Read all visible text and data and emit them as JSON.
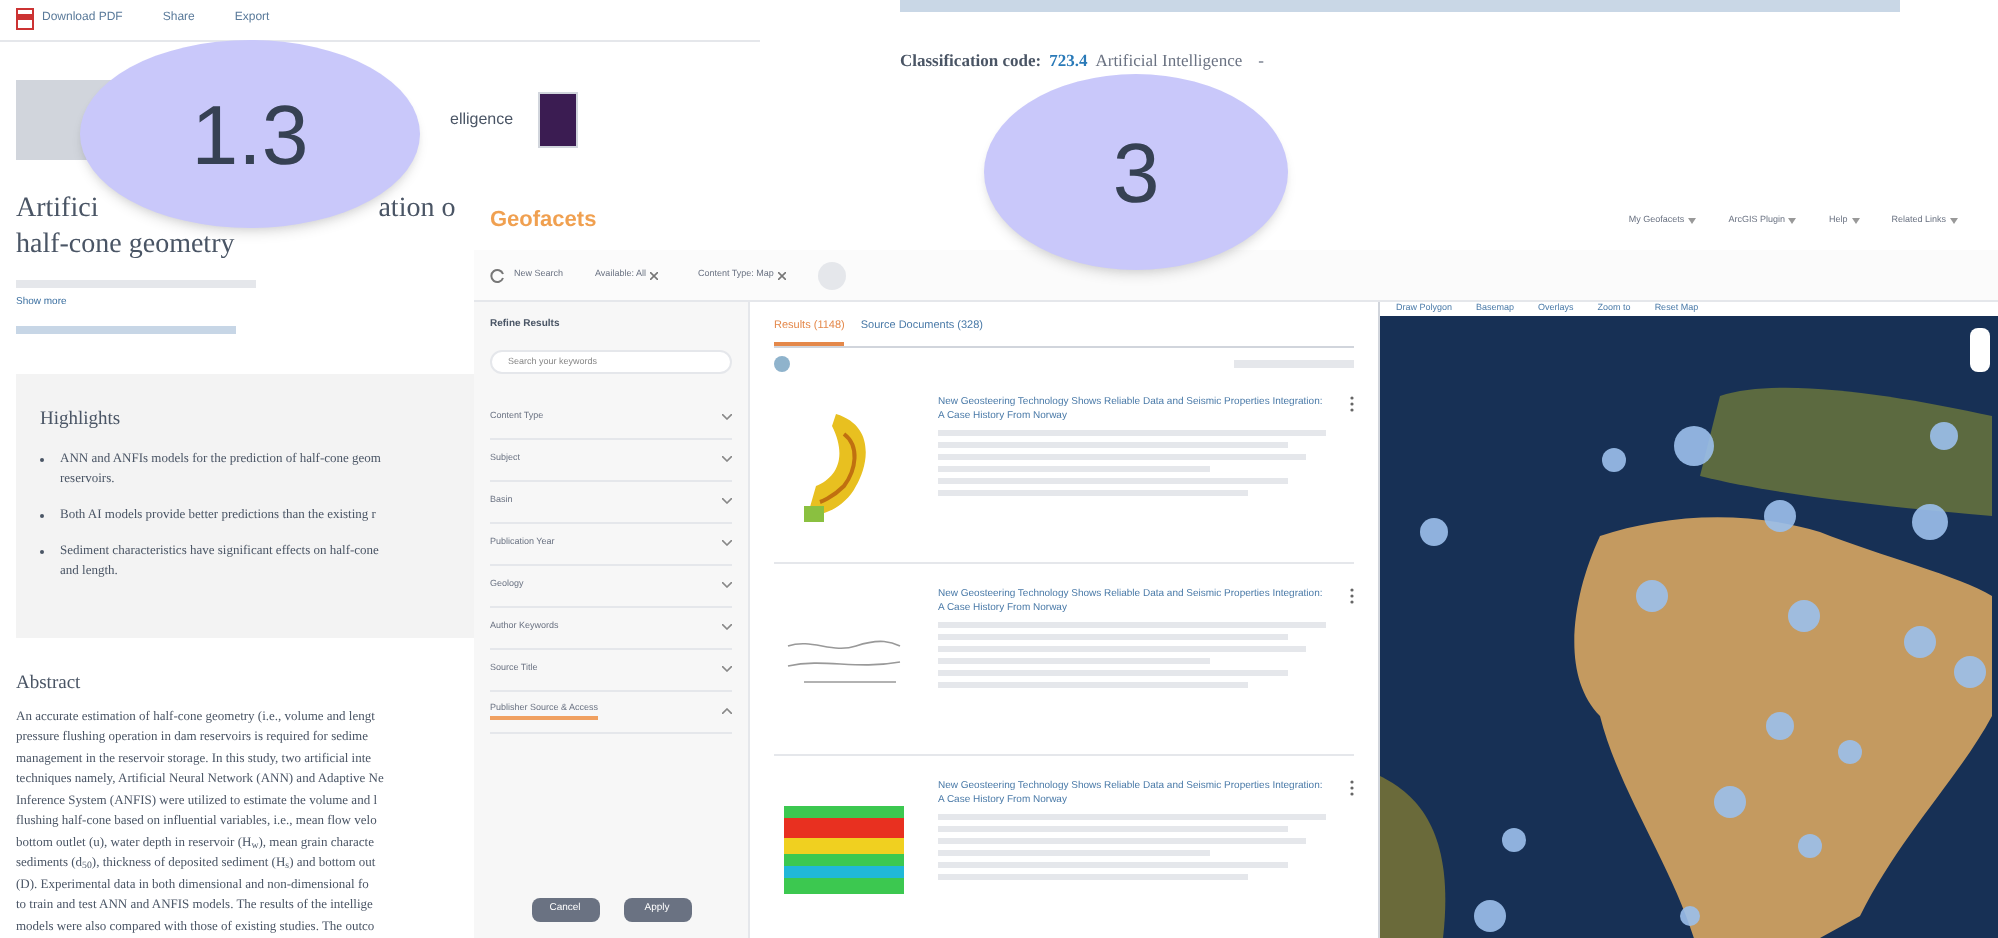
{
  "article": {
    "actions": [
      "Download PDF",
      "Share",
      "Export"
    ],
    "journal_fragment": "elligence",
    "title_fragments": [
      "Artifici",
      "ation o"
    ],
    "title_line_2": "half-cone geometry",
    "show_more": "Show more",
    "highlights": {
      "heading": "Highlights",
      "items": [
        {
          "lines": [
            "ANN and ANFIs models for the prediction of half-cone geom",
            "reservoirs."
          ]
        },
        {
          "lines": [
            "Both AI models provide better predictions than the existing r"
          ]
        },
        {
          "lines": [
            "Sediment characteristics have significant effects on half-cone",
            "and length."
          ]
        }
      ]
    },
    "abstract": {
      "heading": "Abstract",
      "lines": [
        "An accurate estimation of half-cone geometry (i.e., volume and lengt",
        "pressure flushing operation in dam reservoirs is required for sedime",
        "management in the reservoir storage. In this study, two artificial inte",
        "techniques namely, Artificial Neural Network (ANN) and Adaptive Ne",
        "Inference System (ANFIS) were utilized to estimate the volume and l",
        "flushing half-cone based on influential variables, i.e., mean flow velo",
        "bottom outlet (u), water depth in reservoir (H$_{w}$), mean grain characte",
        "sediments (d$_{50}$), thickness of deposited sediment (H$_{s}$) and bottom out",
        "(D). Experimental data in both dimensional and non-dimensional fo",
        "to train and test ANN and ANFIS models. The results of the intellige",
        "models were also compared with those of existing studies. The outco"
      ]
    }
  },
  "classification": {
    "label": "Classification code:",
    "code": "723.4",
    "text": "Artificial Intelligence",
    "separator": "-"
  },
  "callouts": [
    "1.3",
    "3"
  ],
  "geofacets": {
    "logo": "Geofacets",
    "nav": [
      "My Geofacets",
      "ArcGIS Plugin",
      "Help",
      "Related Links"
    ],
    "new_search": "New Search",
    "chips": [
      "Available: All",
      "Content Type: Map"
    ],
    "refine": {
      "heading": "Refine Results",
      "placeholder": "Search your keywords",
      "filters": [
        {
          "label": "Content Type",
          "expanded": false
        },
        {
          "label": "Subject",
          "expanded": false
        },
        {
          "label": "Basin",
          "expanded": false
        },
        {
          "label": "Publication Year",
          "expanded": false
        },
        {
          "label": "Geology",
          "expanded": false
        },
        {
          "label": "Author Keywords",
          "expanded": false
        },
        {
          "label": "Source Title",
          "expanded": false
        },
        {
          "label": "Publisher Source & Access",
          "expanded": true
        }
      ],
      "buttons": [
        "Cancel",
        "Apply"
      ]
    },
    "tabs": [
      {
        "label": "Results (1148)",
        "selected": true
      },
      {
        "label": "Source Documents (328)",
        "selected": false
      }
    ],
    "results": [
      {
        "title": "New Geosteering Technology Shows Reliable Data and Seismic Properties Integration: A Case History From Norway",
        "kind": "contour"
      },
      {
        "title": "New Geosteering Technology Shows Reliable Data and Seismic Properties Integration: A Case History From Norway",
        "kind": "section"
      },
      {
        "title": "New Geosteering Technology Shows Reliable Data and Seismic Properties Integration: A Case History From Norway",
        "kind": "heatmap"
      }
    ],
    "map_tools": [
      "Draw Polygon",
      "Basemap",
      "Overlays",
      "Zoom to",
      "Reset Map"
    ]
  }
}
